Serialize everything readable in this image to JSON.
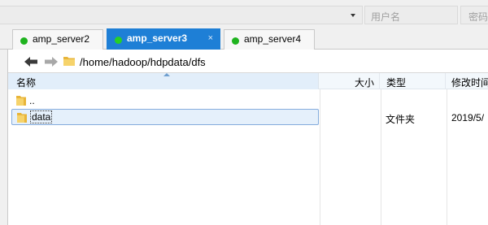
{
  "topbar": {
    "username_placeholder": "用户名",
    "password_placeholder": "密码"
  },
  "tabs": [
    {
      "label": "amp_server2",
      "active": false
    },
    {
      "label": "amp_server3",
      "active": true,
      "close": "×"
    },
    {
      "label": "amp_server4",
      "active": false
    }
  ],
  "pathbar": {
    "path": "/home/hadoop/hdpdata/dfs"
  },
  "columns": {
    "name": "名称",
    "size": "大小",
    "type": "类型",
    "mtime": "修改时间"
  },
  "files": [
    {
      "name": "..",
      "size": "",
      "type": "",
      "mtime": ""
    },
    {
      "name": "data",
      "size": "",
      "type": "文件夹",
      "mtime": "2019/5/",
      "selected": true
    }
  ],
  "colors": {
    "tab_active": "#1e7fd6",
    "status_dot": "#1fb31f",
    "folder": "#f2c94c"
  }
}
